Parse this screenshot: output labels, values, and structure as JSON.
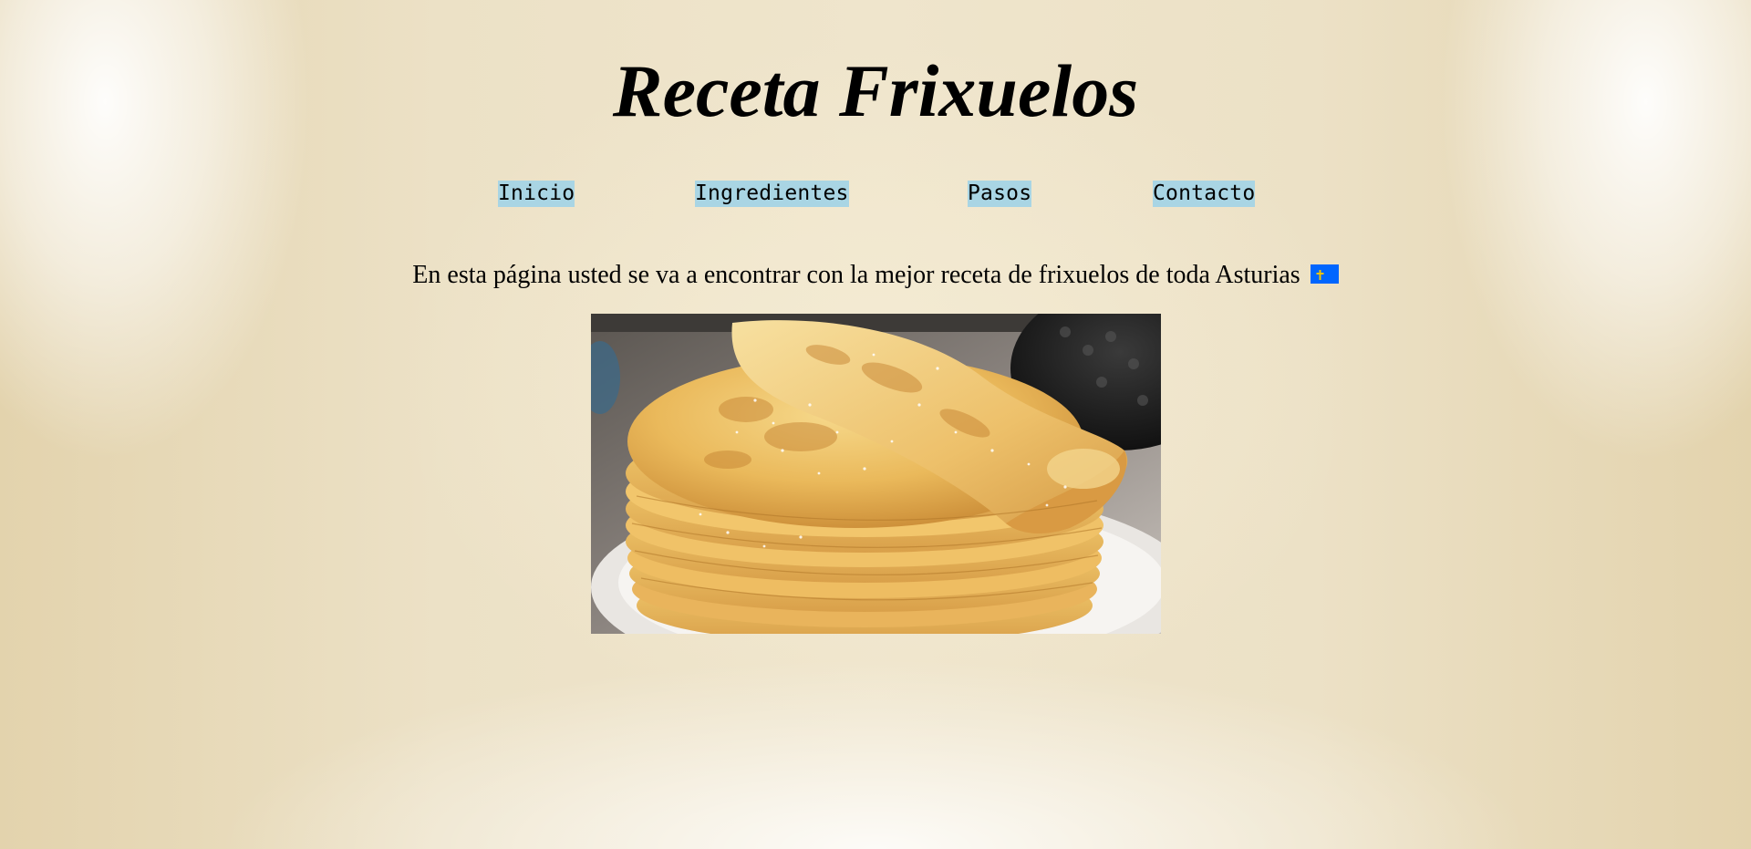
{
  "header": {
    "title": "Receta Frixuelos"
  },
  "nav": {
    "items": [
      {
        "label": "Inicio"
      },
      {
        "label": "Ingredientes"
      },
      {
        "label": "Pasos"
      },
      {
        "label": "Contacto"
      }
    ],
    "link_bg_color": "#a9d5e4"
  },
  "main": {
    "intro_text": "En esta página usted se va a encontrar con la mejor receta de frixuelos de toda Asturias",
    "flag_icon": "asturias-flag-icon",
    "photo_subject": "stack of frixuelos (crepes) with sugar"
  },
  "colors": {
    "background": "#ece1c6",
    "flag_blue": "#0066ff",
    "flag_cross": "#f5c400"
  }
}
